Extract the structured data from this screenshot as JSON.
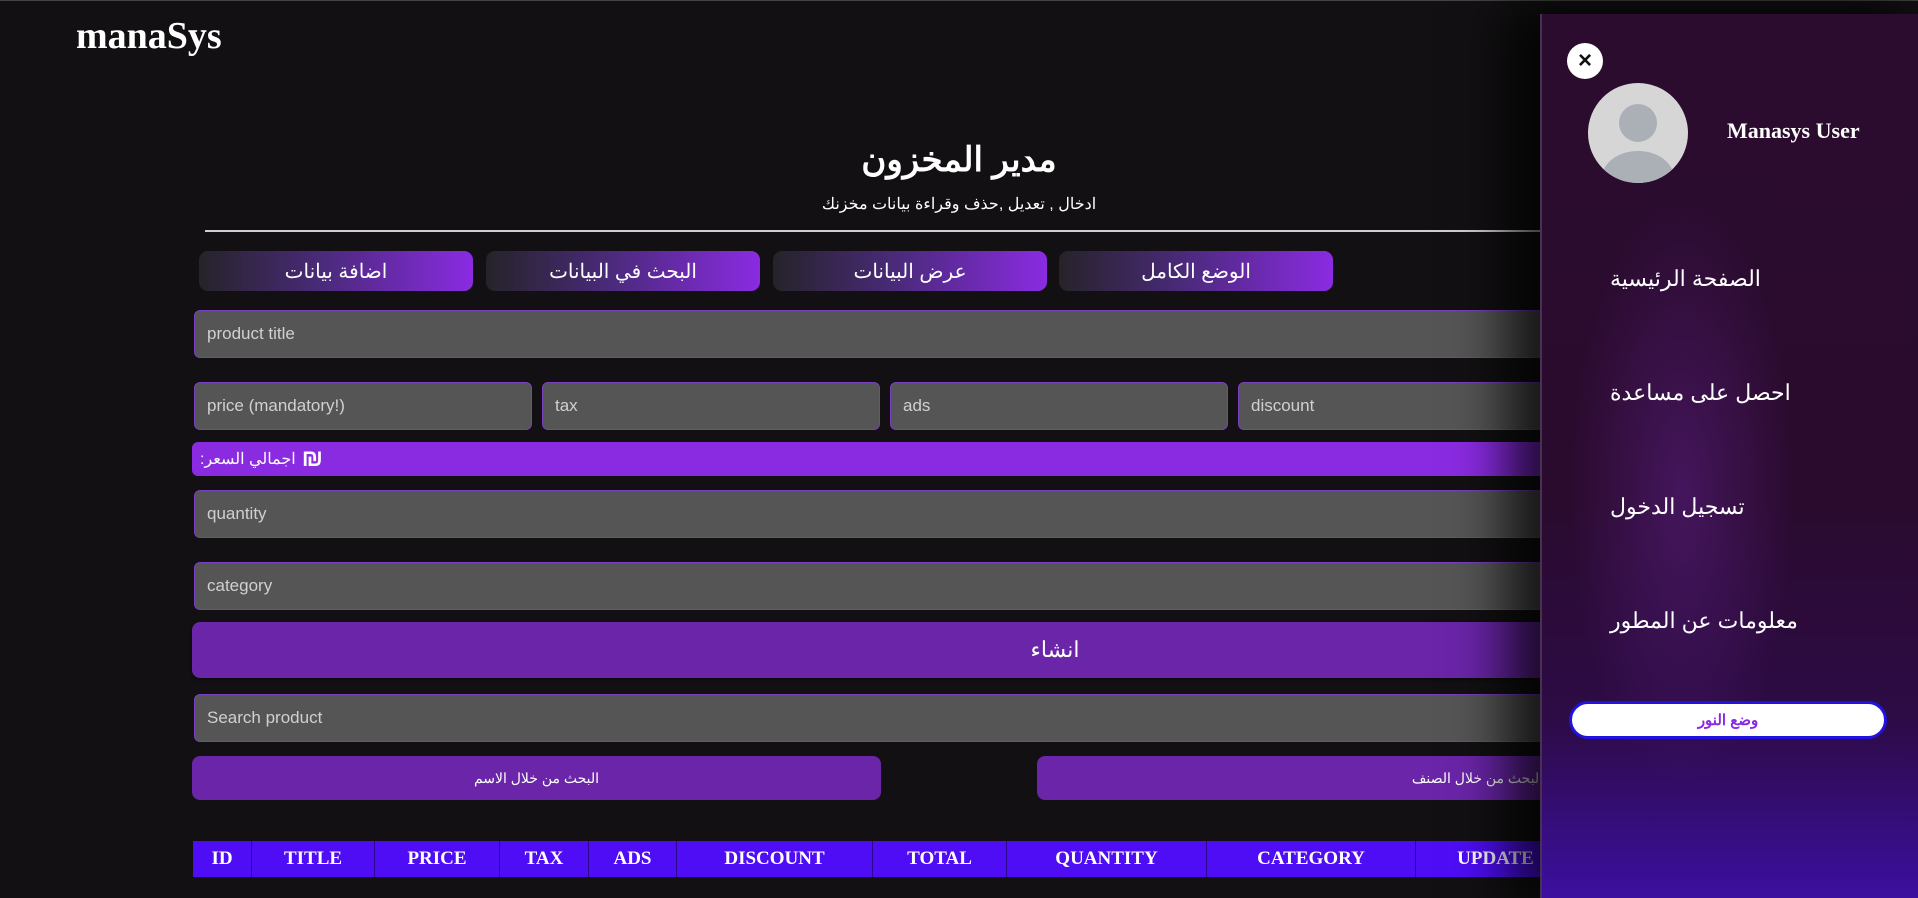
{
  "app": {
    "logo": "manaSys"
  },
  "header": {
    "title": "مدير المخزون",
    "subtitle": "ادخال , تعديل ,حذف وقراءة بيانات مخزنك"
  },
  "tabs": [
    {
      "label": "اضافة بيانات"
    },
    {
      "label": "البحث في البيانات"
    },
    {
      "label": "عرض البيانات"
    },
    {
      "label": "الوضع الكامل"
    }
  ],
  "form": {
    "title_placeholder": "product title",
    "price_placeholder": "price (mandatory!)",
    "tax_placeholder": "tax",
    "ads_placeholder": "ads",
    "discount_placeholder": "discount",
    "total_label": "اجمالي السعر:",
    "currency_symbol": "₪",
    "quantity_placeholder": "quantity",
    "category_placeholder": "category",
    "create_label": "انشاء"
  },
  "search": {
    "placeholder": "Search product",
    "by_name_label": "البحث من خلال الاسم",
    "by_category_label": "البحث من خلال الصنف"
  },
  "table": {
    "columns": [
      "ID",
      "TITLE",
      "PRICE",
      "TAX",
      "ADS",
      "DISCOUNT",
      "TOTAL",
      "QUANTITY",
      "CATEGORY",
      "UPDATE"
    ]
  },
  "sidebar": {
    "close_icon": "×",
    "username": "Manasys User",
    "menu": [
      {
        "label": "الصفحة الرئيسية"
      },
      {
        "label": "احصل على مساعدة"
      },
      {
        "label": "تسجيل الدخول"
      },
      {
        "label": "معلومات عن المطور"
      }
    ],
    "light_mode_label": "وضع النور"
  },
  "colors": {
    "accent": "#8a2be2",
    "button": "#6a25a8",
    "table_header": "#4e0df5",
    "background": "#121012"
  }
}
